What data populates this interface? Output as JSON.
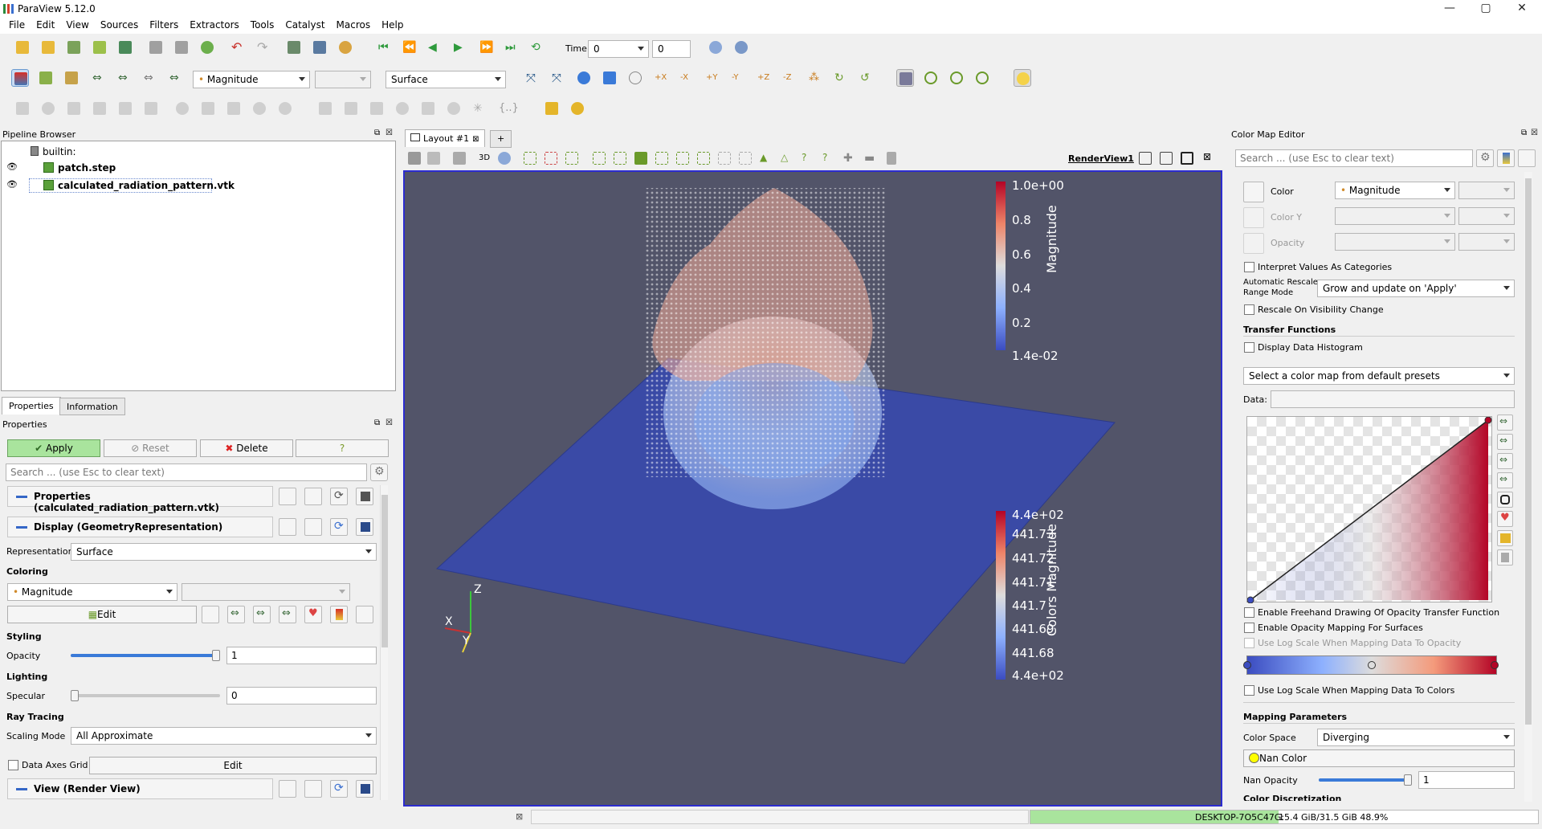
{
  "app": {
    "title": "ParaView 5.12.0"
  },
  "menu": [
    "File",
    "Edit",
    "View",
    "Sources",
    "Filters",
    "Extractors",
    "Tools",
    "Catalyst",
    "Macros",
    "Help"
  ],
  "time": {
    "label": "Time:",
    "value": "0",
    "step": "0"
  },
  "toolbar2": {
    "color_by": "Magnitude",
    "representation": "Surface"
  },
  "pipeline": {
    "title": "Pipeline Browser",
    "root": "builtin:",
    "items": [
      "patch.step",
      "calculated_radiation_pattern.vtk"
    ]
  },
  "tabs": {
    "properties": "Properties",
    "information": "Information"
  },
  "properties": {
    "title": "Properties",
    "apply": "Apply",
    "reset": "Reset",
    "delete": "Delete",
    "help": "?",
    "search_placeholder": "Search ... (use Esc to clear text)",
    "section1": "Properties (calculated_radiation_pattern.vtk)",
    "section2": "Display (GeometryRepresentation)",
    "representation_label": "Representation",
    "representation_value": "Surface",
    "coloring_label": "Coloring",
    "coloring_value": "Magnitude",
    "edit": "Edit",
    "styling_label": "Styling",
    "opacity_label": "Opacity",
    "opacity_value": "1",
    "opacity_fraction": 1.0,
    "lighting_label": "Lighting",
    "specular_label": "Specular",
    "specular_value": "0",
    "raytracing_label": "Ray Tracing",
    "scaling_label": "Scaling Mode",
    "scaling_value": "All Approximate",
    "data_axes_label": "Data Axes Grid",
    "data_axes_edit": "Edit",
    "section3": "View (Render View)"
  },
  "layout": {
    "tab": "Layout #1",
    "plus": "+",
    "view_name": "RenderView1",
    "mode": "3D"
  },
  "colorbar1": {
    "title": "Magnitude",
    "ticks": [
      "1.0e+00",
      "0.8",
      "0.6",
      "0.4",
      "0.2",
      "1.4e-02"
    ]
  },
  "colorbar2": {
    "title": "Colors Magnitude",
    "ticks": [
      "4.4e+02",
      "441.73",
      "441.72",
      "441.71",
      "441.7",
      "441.69",
      "441.68",
      "4.4e+02"
    ]
  },
  "axes": {
    "x": "X",
    "y": "Y",
    "z": "Z"
  },
  "cme": {
    "title": "Color Map Editor",
    "search_placeholder": "Search ... (use Esc to clear text)",
    "color_label": "Color",
    "color_value": "Magnitude",
    "colory_label": "Color Y",
    "opacity_label": "Opacity",
    "interpret": "Interpret Values As Categories",
    "auto_rescale_label1": "Automatic Rescale",
    "auto_rescale_label2": "Range Mode",
    "auto_rescale_value": "Grow and update on 'Apply'",
    "rescale_vis": "Rescale On Visibility Change",
    "transfer_label": "Transfer Functions",
    "histogram": "Display Data Histogram",
    "preset": "Select a color map from default presets",
    "data_label": "Data:",
    "freehand": "Enable Freehand Drawing Of Opacity Transfer Function",
    "opacity_surfaces": "Enable Opacity Mapping For Surfaces",
    "log_opacity": "Use Log Scale When Mapping Data To Opacity",
    "log_colors": "Use Log Scale When Mapping Data To Colors",
    "mapping_label": "Mapping Parameters",
    "colorspace_label": "Color Space",
    "colorspace_value": "Diverging",
    "nan_color": "Nan Color",
    "nan_opacity_label": "Nan Opacity",
    "nan_opacity_value": "1",
    "nan_opacity_fraction": 1.0,
    "discretization": "Color Discretization"
  },
  "status": {
    "host": "DESKTOP-7O5C47G:",
    "memory": "15.4 GiB/31.5 GiB 48.9%",
    "memory_fraction": 0.489
  },
  "colors": {
    "accent": "#3567c7",
    "render_bg": "#525469",
    "plane": "#3a4aa6",
    "apply_bg": "#a9e49d"
  }
}
